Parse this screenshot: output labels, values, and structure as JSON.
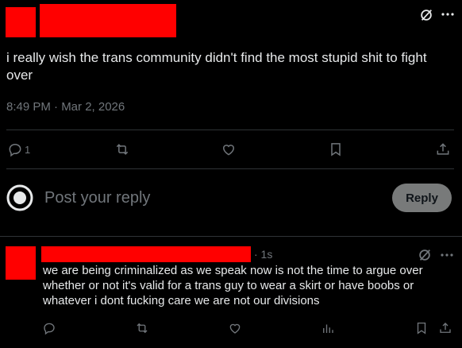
{
  "post": {
    "text": "i really wish the trans community didn't find the most stupid shit to fight over",
    "meta": "8:49 PM · Mar 2, 2026",
    "reply_count": "1"
  },
  "icons": {
    "grok": "grok-icon",
    "more": "more-icon",
    "reply": "reply-icon",
    "repost": "repost-icon",
    "like": "heart-icon",
    "bookmark": "bookmark-icon",
    "share": "share-icon",
    "views": "views-icon"
  },
  "composer": {
    "placeholder": "Post your reply",
    "button": "Reply"
  },
  "reply": {
    "time": "· 1s",
    "text": "we are being criminalized as we speak now is not the time to argue over whether or not it's valid for a trans guy to wear a skirt or have boobs or whatever i dont fucking care we are not our divisions"
  },
  "colors": {
    "background": "#000000",
    "text": "#e7e9ea",
    "muted": "#71767b",
    "divider": "#2f3336",
    "redaction": "#ff0000",
    "reply_button": "#787a7a"
  }
}
